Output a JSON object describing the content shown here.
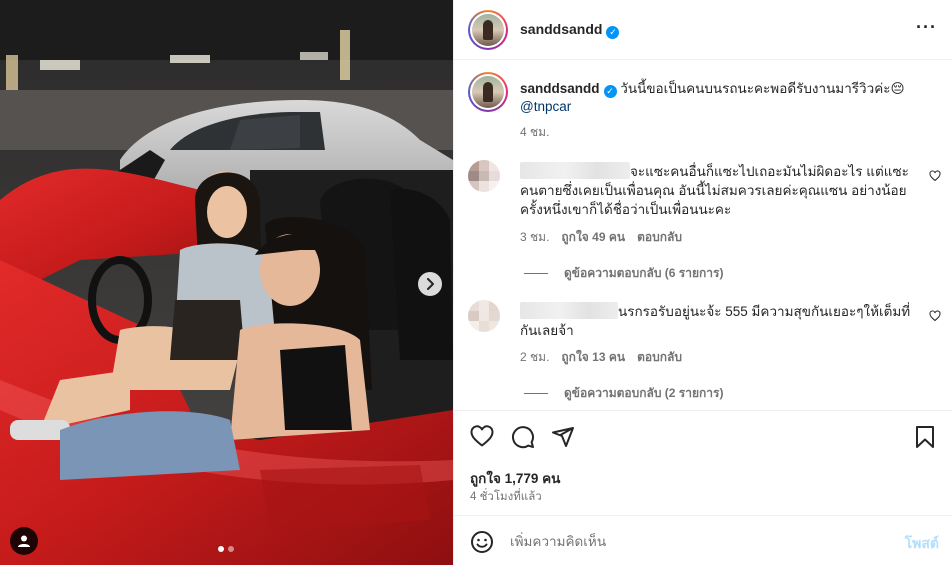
{
  "post": {
    "username": "sanddsandd",
    "more_icon": "more-horizontal-icon",
    "verified_icon": "verified-badge-icon"
  },
  "caption": {
    "username": "sanddsandd",
    "text": "วันนี้ขอเป็นคนบนรถนะคะพอดีรับงานมารีวิวค่ะ",
    "emoji": "😔",
    "mention": "@tnpcar",
    "time": "4 ชม."
  },
  "comments": [
    {
      "text_visible": "จะแซะคนอื่นก็แซะไปเถอะมันไม่ผิดอะไร แต่แซะคนตายซึ่งเคยเป็นเพื่อนคุณ อันนี้ไม่สมควรเลยค่ะคุณแซน อย่างน้อยครั้งหนึ่งเขาก็ได้ชื่อว่าเป็นเพื่อนนะคะ",
      "time": "3 ชม.",
      "likes": "ถูกใจ 49 คน",
      "reply": "ตอบกลับ",
      "view_replies": "ดูข้อความตอบกลับ (6 รายการ)"
    },
    {
      "text_visible": "นรกรอรับอยู่นะจ้ะ 555 มีความสุขกันเยอะๆให้เต็มที่กันเลยจ้า",
      "time": "2 ชม.",
      "likes": "ถูกใจ 13 คน",
      "reply": "ตอบกลับ",
      "view_replies": "ดูข้อความตอบกลับ (2 รายการ)"
    }
  ],
  "actions": {
    "like_icon": "heart-icon",
    "comment_icon": "comment-icon",
    "share_icon": "share-icon",
    "save_icon": "bookmark-icon"
  },
  "likes_count": "ถูกใจ 1,779 คน",
  "posted_ago": "4 ชั่วโมงที่แล้ว",
  "add_comment": {
    "placeholder": "เพิ่มความคิดเห็น",
    "post_label": "โพสต์",
    "emoji_icon": "emoji-icon"
  },
  "carousel": {
    "current_slide": 1,
    "total_slides": 2,
    "next_icon": "chevron-right-icon",
    "tag_icon": "user-tag-icon"
  }
}
